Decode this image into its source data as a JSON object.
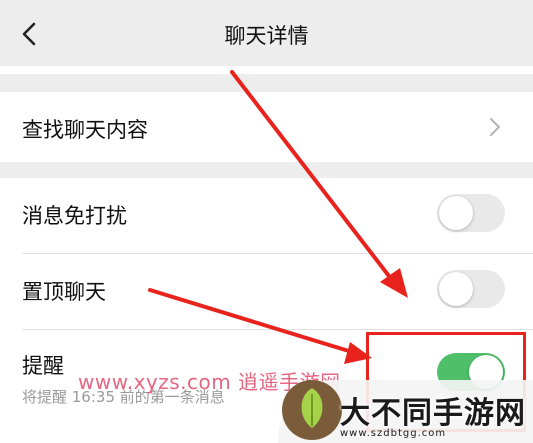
{
  "header": {
    "title": "聊天详情"
  },
  "rows": {
    "search": {
      "label": "查找聊天内容"
    },
    "mute": {
      "label": "消息免打扰",
      "on": false
    },
    "pin": {
      "label": "置顶聊天",
      "on": false
    },
    "remind": {
      "label": "提醒",
      "on": true,
      "sub": "将提醒 16:35 前的第一条消息"
    }
  },
  "overlay": {
    "watermark": "www.xyzs.com 逍遥手游网",
    "logo_text": "大不同手游网",
    "logo_url": "www.szdbtgg.com",
    "arrow_color": "#e8231d"
  },
  "colors": {
    "toggle_on": "#4fbf6a",
    "toggle_off": "#e9e9e9",
    "background": "#ededed"
  }
}
